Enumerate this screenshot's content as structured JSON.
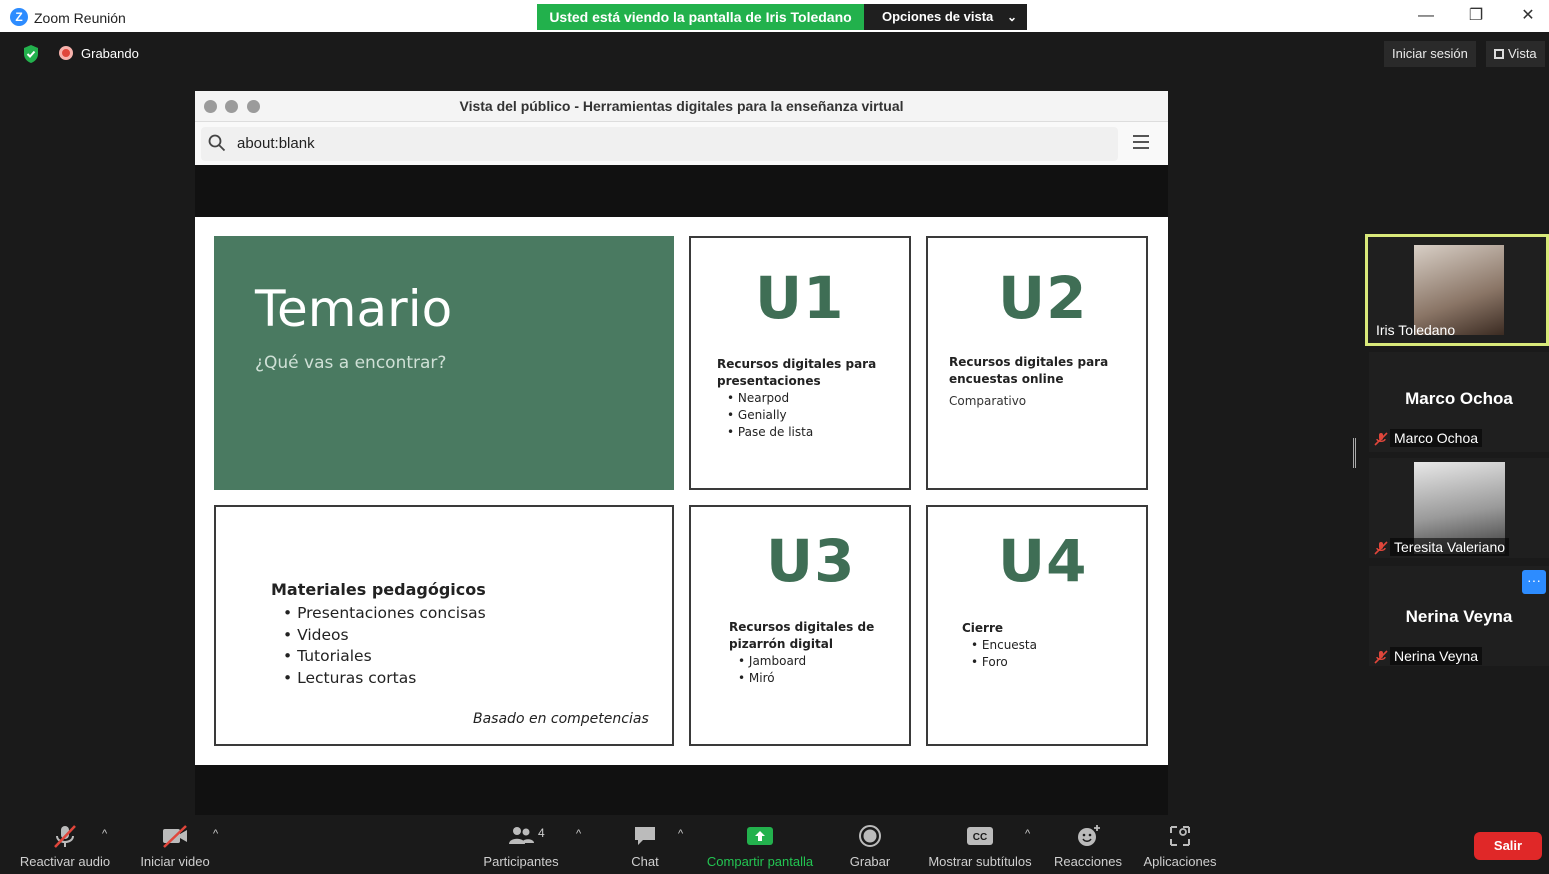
{
  "window": {
    "app_title": "Zoom Reunión",
    "logo_letter": "Z",
    "minimize": "—",
    "maximize": "❐",
    "close": "✕"
  },
  "banner": {
    "viewing_text": "Usted está viendo la pantalla de Iris Toledano",
    "view_options_label": "Opciones de vista",
    "view_options_chevron": "⌄"
  },
  "meeting_bar": {
    "recording_label": "Grabando",
    "sign_in_label": "Iniciar sesión",
    "view_label": "Vista"
  },
  "browser": {
    "title": "Vista del público - Herramientas digitales para la enseñanza virtual",
    "url": "about:blank"
  },
  "slide": {
    "title": "Temario",
    "subtitle": "¿Qué vas a encontrar?",
    "materials": {
      "heading": "Materiales pedagógicos",
      "items": [
        "Presentaciones concisas",
        "Videos",
        "Tutoriales",
        "Lecturas cortas"
      ],
      "note": "Basado en competencias"
    },
    "u1": {
      "code": "U1",
      "heading_l1": "Recursos digitales para",
      "heading_l2": "presentaciones",
      "items": [
        "Nearpod",
        "Genially",
        "Pase de lista"
      ]
    },
    "u2": {
      "code": "U2",
      "heading_l1": "Recursos digitales para",
      "heading_l2": "encuestas online",
      "note": "Comparativo"
    },
    "u3": {
      "code": "U3",
      "heading_l1": "Recursos digitales de",
      "heading_l2": "pizarrón digital",
      "items": [
        "Jamboard",
        "Miró"
      ]
    },
    "u4": {
      "code": "U4",
      "heading": "Cierre",
      "items": [
        "Encuesta",
        "Foro"
      ]
    }
  },
  "participants_panel": {
    "tiles": [
      {
        "name": "Iris Toledano"
      },
      {
        "name": "Marco Ochoa",
        "big_name": "Marco Ochoa"
      },
      {
        "name": "Teresita Valeriano"
      },
      {
        "name": "Nerina Veyna",
        "big_name": "Nerina Veyna"
      }
    ],
    "more_label": "···"
  },
  "toolbar": {
    "audio": "Reactivar audio",
    "video": "Iniciar video",
    "participants": "Participantes",
    "participants_count": "4",
    "chat": "Chat",
    "share": "Compartir pantalla",
    "record": "Grabar",
    "captions": "Mostrar subtítulos",
    "reactions": "Reacciones",
    "apps": "Aplicaciones",
    "leave": "Salir",
    "caret": "^"
  },
  "colors": {
    "accent_green": "#22b14c",
    "slide_green": "#4a7a61",
    "active_border": "#d9e97a",
    "leave_red": "#e02828",
    "zoom_blue": "#2d8cff"
  }
}
